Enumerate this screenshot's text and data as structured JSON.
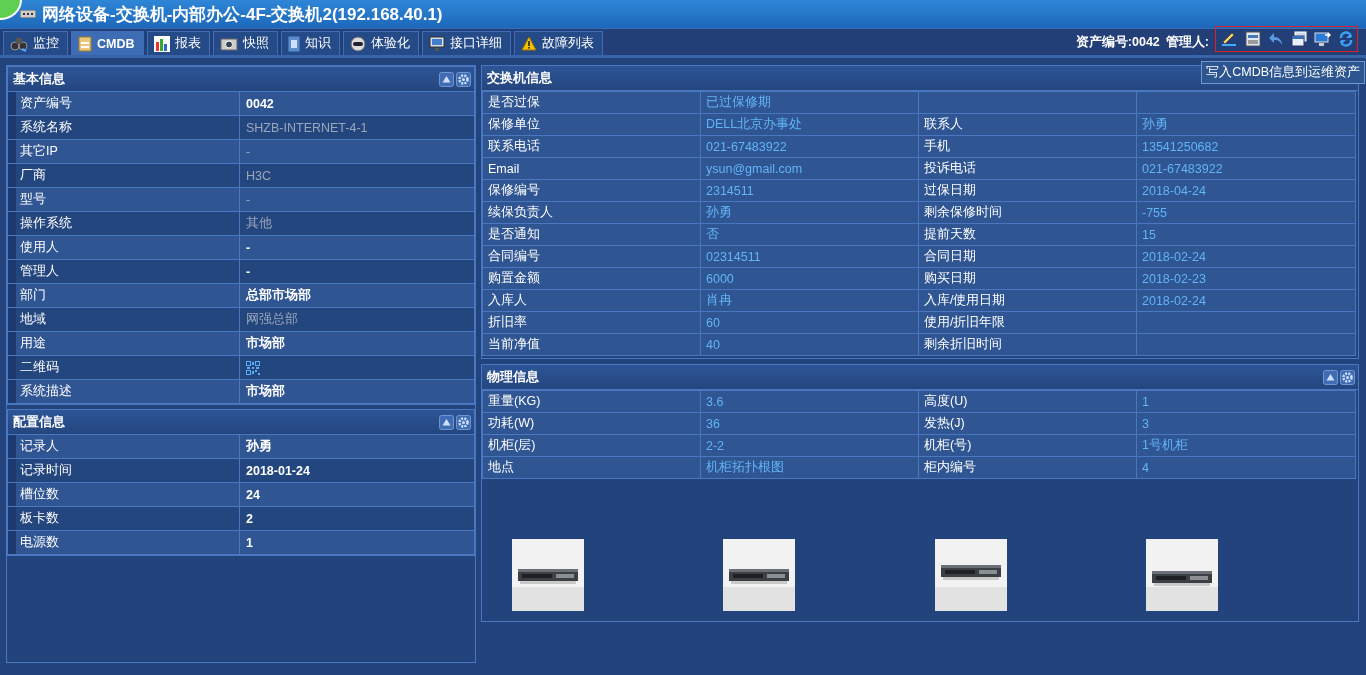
{
  "window": {
    "title": "网络设备-交换机-内部办公-4F-交换机2(192.168.40.1)"
  },
  "tabs": [
    {
      "label": "监控",
      "selected": false
    },
    {
      "label": "CMDB",
      "selected": true
    },
    {
      "label": "报表",
      "selected": false
    },
    {
      "label": "快照",
      "selected": false
    },
    {
      "label": "知识",
      "selected": false
    },
    {
      "label": "体验化",
      "selected": false
    },
    {
      "label": "接口详细",
      "selected": false
    },
    {
      "label": "故障列表",
      "selected": false
    }
  ],
  "header_info": {
    "asset_no": "资产编号:0042",
    "manager": "管理人:"
  },
  "tooltip": "写入CMDB信息到运维资产",
  "basic_info": {
    "title": "基本信息",
    "rows": [
      {
        "kind": "text",
        "label": "资产编号",
        "value": "0042",
        "muted": false
      },
      {
        "kind": "text",
        "label": "系统名称",
        "value": "SHZB-INTERNET-4-1",
        "muted": true
      },
      {
        "kind": "text",
        "label": "其它IP",
        "value": "-",
        "muted": true
      },
      {
        "kind": "text",
        "label": "厂商",
        "value": "H3C",
        "muted": true
      },
      {
        "kind": "text",
        "label": "型号",
        "value": "-",
        "muted": true
      },
      {
        "kind": "text",
        "label": "操作系统",
        "value": "其他",
        "muted": true
      },
      {
        "kind": "text",
        "label": "使用人",
        "value": "-",
        "muted": false
      },
      {
        "kind": "text",
        "label": "管理人",
        "value": "-",
        "muted": false
      },
      {
        "kind": "text",
        "label": "部门",
        "value": "总部市场部",
        "muted": false
      },
      {
        "kind": "text",
        "label": "地域",
        "value": "网强总部",
        "muted": true
      },
      {
        "kind": "text",
        "label": "用途",
        "value": "市场部",
        "muted": false
      },
      {
        "kind": "qrcode",
        "label": "二维码"
      },
      {
        "kind": "text",
        "label": "系统描述",
        "value": "市场部",
        "muted": false
      }
    ]
  },
  "config_info": {
    "title": "配置信息",
    "rows": [
      {
        "kind": "text",
        "label": "记录人",
        "value": "孙勇",
        "muted": false
      },
      {
        "kind": "text",
        "label": "记录时间",
        "value": "2018-01-24",
        "muted": false
      },
      {
        "kind": "text",
        "label": "槽位数",
        "value": "24",
        "muted": false
      },
      {
        "kind": "text",
        "label": "板卡数",
        "value": "2",
        "muted": false
      },
      {
        "kind": "text",
        "label": "电源数",
        "value": "1",
        "muted": false
      }
    ]
  },
  "switch_info": {
    "title": "交换机信息",
    "rows": [
      [
        {
          "label": "是否过保",
          "value": "已过保修期"
        }
      ],
      [
        {
          "label": "保修单位",
          "value": "DELL北京办事处"
        },
        {
          "label": "联系人",
          "value": "孙勇"
        }
      ],
      [
        {
          "label": "联系电话",
          "value": "021-67483922"
        },
        {
          "label": "手机",
          "value": "13541250682"
        }
      ],
      [
        {
          "label": "Email",
          "value": "ysun@gmail.com"
        },
        {
          "label": "投诉电话",
          "value": "021-67483922"
        }
      ],
      [
        {
          "label": "保修编号",
          "value": "2314511"
        },
        {
          "label": "过保日期",
          "value": "2018-04-24"
        }
      ],
      [
        {
          "label": "续保负责人",
          "value": "孙勇"
        },
        {
          "label": "剩余保修时间",
          "value": "-755"
        }
      ],
      [
        {
          "label": "是否通知",
          "value": "否"
        },
        {
          "label": "提前天数",
          "value": "15"
        }
      ],
      [
        {
          "label": "合同编号",
          "value": "02314511"
        },
        {
          "label": "合同日期",
          "value": "2018-02-24"
        }
      ],
      [
        {
          "label": "购置金额",
          "value": "6000"
        },
        {
          "label": "购买日期",
          "value": "2018-02-23"
        }
      ],
      [
        {
          "label": "入库人",
          "value": "肖冉"
        },
        {
          "label": "入库/使用日期",
          "value": "2018-02-24"
        }
      ],
      [
        {
          "label": "折旧率",
          "value": "60"
        },
        {
          "label": "使用/折旧年限"
        }
      ],
      [
        {
          "label": "当前净值",
          "value": "40"
        },
        {
          "label": "剩余折旧时间"
        }
      ]
    ]
  },
  "physical_info": {
    "title": "物理信息",
    "rows": [
      [
        {
          "label": "重量(KG)",
          "value": "3.6"
        },
        {
          "label": "高度(U)",
          "value": "1"
        }
      ],
      [
        {
          "label": "功耗(W)",
          "value": "36"
        },
        {
          "label": "发热(J)",
          "value": "3"
        }
      ],
      [
        {
          "label": "机柜(层)",
          "value": "2-2"
        },
        {
          "label": "机柜(号)",
          "value": "1号机柜"
        }
      ],
      [
        {
          "label": "地点",
          "value": "机柜拓扑根图"
        },
        {
          "label": "柜内编号",
          "value": "4"
        }
      ]
    ]
  }
}
